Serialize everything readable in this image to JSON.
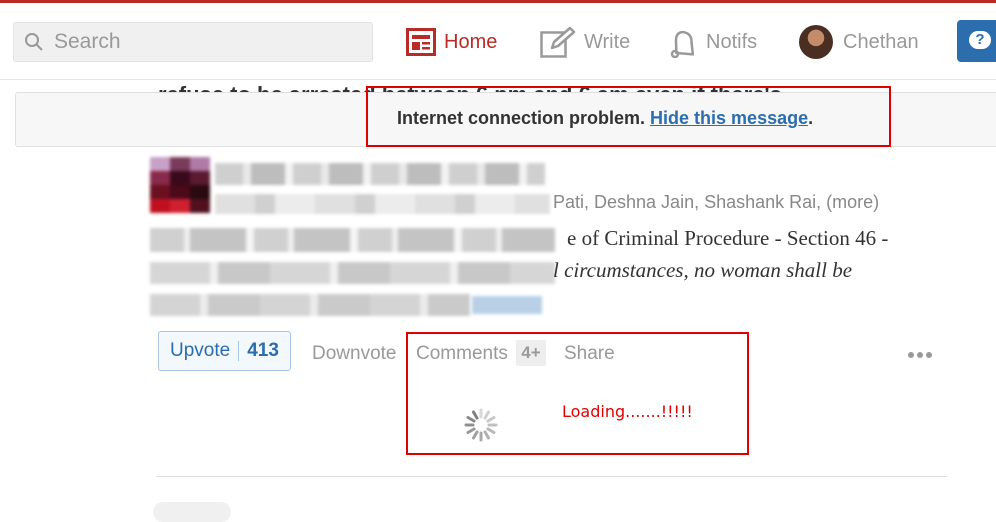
{
  "header": {
    "search_placeholder": "Search",
    "nav": {
      "home": "Home",
      "write": "Write",
      "notifs": "Notifs",
      "profile": "Chethan"
    },
    "ask_icon": "question-bubble-icon"
  },
  "background_title": "refuse to be arrested between 6 pm and 6 am even if there's",
  "notice": {
    "message": "Internet connection problem.",
    "link": "Hide this message",
    "trailing": "."
  },
  "answer": {
    "authors_visible": "Pati, Deshna Jain, Shashank Rai, (more)",
    "line1_visible": "e of Criminal Procedure - Section 46 -",
    "line2_visible": "l circumstances, no woman shall be"
  },
  "actions": {
    "upvote_label": "Upvote",
    "upvote_count": "413",
    "downvote_label": "Downvote",
    "comments_label": "Comments",
    "comments_count": "4+",
    "share_label": "Share"
  },
  "annotation": {
    "loading_text": "Loading.......!!!!!"
  },
  "colors": {
    "brand_red": "#b92b27",
    "link_blue": "#2b6dad",
    "annotation_red": "#e00000"
  }
}
